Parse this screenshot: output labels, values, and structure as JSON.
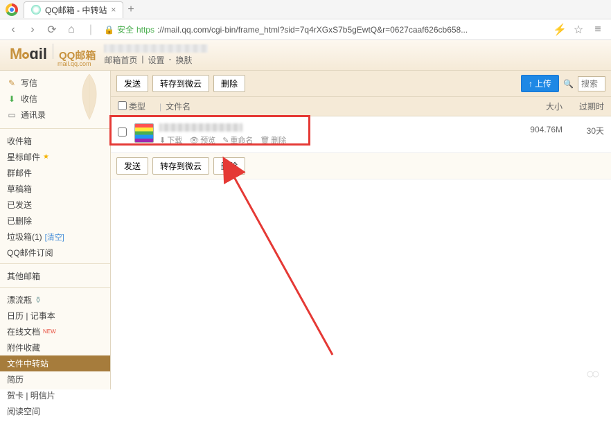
{
  "browser": {
    "tab_title": "QQ邮箱 - 中转站",
    "safe_label": "安全",
    "https": "https",
    "url_rest": "://mail.qq.com/cgi-bin/frame_html?sid=7q4rXGxS7b5gEwtQ&r=0627caaf626cb658...",
    "nav": {
      "back": "‹",
      "fwd": "›",
      "reload": "⟳",
      "home": "⌂"
    }
  },
  "header": {
    "logo_m": "M",
    "logo_oil": "ɑil",
    "logo_qq": "QQ邮箱",
    "logo_sub": "mail.qq.com",
    "link_home": "邮箱首页",
    "link_settings": "设置",
    "link_skin": "换肤",
    "sep": "|"
  },
  "sidebar": {
    "top": [
      {
        "icon": "✎",
        "label": "写信",
        "color": "#c7923e"
      },
      {
        "icon": "✉",
        "label": "收信",
        "color": "#4caf50"
      },
      {
        "icon": "▭",
        "label": "通讯录",
        "color": "#888"
      }
    ],
    "folders": [
      {
        "label": "收件箱"
      },
      {
        "label": "星标邮件",
        "star": true
      },
      {
        "label": "群邮件"
      },
      {
        "label": "草稿箱"
      },
      {
        "label": "已发送"
      },
      {
        "label": "已删除"
      },
      {
        "label": "垃圾箱(1)",
        "clear": "[清空]"
      },
      {
        "label": "QQ邮件订阅"
      }
    ],
    "other_title": "其他邮箱",
    "apps": [
      {
        "label": "漂流瓶",
        "suffix": ""
      },
      {
        "label": "日历 | 记事本"
      },
      {
        "label": "在线文档",
        "new": "NEW"
      },
      {
        "label": "附件收藏"
      },
      {
        "label": "文件中转站",
        "active": true
      },
      {
        "label": "简历"
      },
      {
        "label": "贺卡 | 明信片"
      },
      {
        "label": "阅读空间"
      }
    ]
  },
  "toolbar": {
    "send": "发送",
    "save_cloud": "转存到微云",
    "delete": "删除",
    "upload": "上传",
    "upload_icon": "↑",
    "search_placeholder": "搜索"
  },
  "columns": {
    "type": "类型",
    "name": "文件名",
    "size": "大小",
    "expire": "过期时",
    "sep": "|"
  },
  "file": {
    "actions": {
      "download": "下载",
      "preview": "预览",
      "rename": "重命名",
      "delete": "删除"
    },
    "size": "904.76M",
    "expire": "30天"
  }
}
